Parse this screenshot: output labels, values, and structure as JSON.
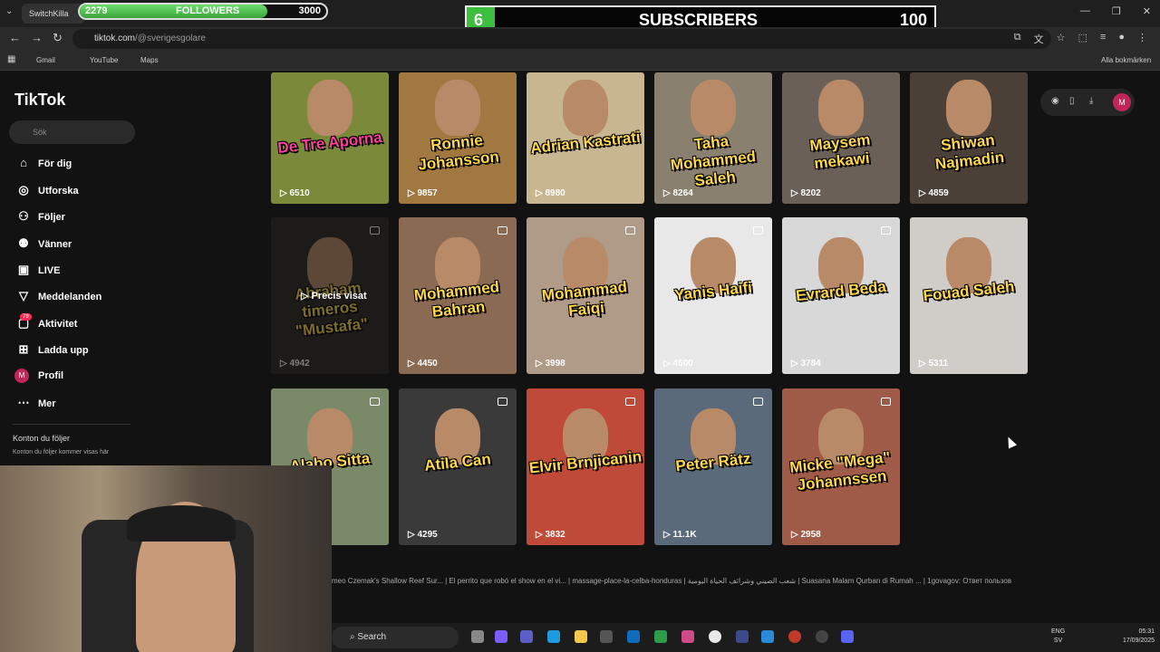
{
  "browser": {
    "tab_title": "SwitchKilla",
    "url_host": "tiktok.com",
    "url_path": "/@sverigesgolare",
    "bookmarks": [
      "Gmail",
      "YouTube",
      "Maps"
    ],
    "all_bookmarks": "Alla bokmärken"
  },
  "overlay": {
    "followers_current": "2279",
    "followers_label": "FOLLOWERS",
    "followers_goal": "3000",
    "followers_fraction": 0.76,
    "subs_current": "6",
    "subs_label": "SUBSCRIBERS",
    "subs_goal": "100",
    "subs_fraction": 0.06
  },
  "sidebar": {
    "logo": "TikTok",
    "search_placeholder": "Sök",
    "items": [
      {
        "label": "För dig",
        "icon": "home-icon"
      },
      {
        "label": "Utforska",
        "icon": "compass-icon"
      },
      {
        "label": "Följer",
        "icon": "following-icon"
      },
      {
        "label": "Vänner",
        "icon": "friends-icon"
      },
      {
        "label": "LIVE",
        "icon": "live-icon"
      },
      {
        "label": "Meddelanden",
        "icon": "messages-icon"
      },
      {
        "label": "Aktivitet",
        "icon": "activity-icon"
      },
      {
        "label": "Ladda upp",
        "icon": "upload-icon"
      },
      {
        "label": "Profil",
        "icon": "profile-icon"
      },
      {
        "label": "Mer",
        "icon": "more-icon"
      }
    ],
    "activity_badge": "79",
    "profile_initial": "M",
    "following_heading": "Konton du följer",
    "following_note": "Konton du följer kommer visas här"
  },
  "videos": [
    {
      "title": "De Tre Aporna",
      "views": "6510",
      "color": "#7a8a3a"
    },
    {
      "title": "Ronnie Johansson",
      "views": "9857",
      "color": "#a07840"
    },
    {
      "title": "Adrian Kastrati",
      "views": "8980",
      "color": "#c8b690"
    },
    {
      "title": "Taha Mohammed Saleh",
      "views": "8264",
      "color": "#8a8070"
    },
    {
      "title": "Maysem mekawi",
      "views": "8202",
      "color": "#6a6058"
    },
    {
      "title": "Shiwan Najmadin",
      "views": "4859",
      "color": "#4a4038"
    },
    {
      "title": "Abraham timeros \"Mustafa\"",
      "views": "4942",
      "color": "#2a2624"
    },
    {
      "title": "Mohammed Bahran",
      "views": "4450",
      "color": "#8a6a52"
    },
    {
      "title": "Mohammad Faiqi",
      "views": "3998",
      "color": "#b09a88"
    },
    {
      "title": "Yanis Haifi",
      "views": "4600",
      "color": "#e8e8e8"
    },
    {
      "title": "Evrard Beda",
      "views": "3784",
      "color": "#d8d8d8"
    },
    {
      "title": "Fouad Saleh",
      "views": "5311",
      "color": "#d0ccc8"
    },
    {
      "title": "Alabo Sitta",
      "views": "",
      "color": "#7a8a68"
    },
    {
      "title": "Atila Can",
      "views": "4295",
      "color": "#3a3a3a"
    },
    {
      "title": "Elvir Brnjicanin",
      "views": "3832",
      "color": "#c04a3a"
    },
    {
      "title": "Peter Rätz",
      "views": "11.1K",
      "color": "#5a6a7a"
    },
    {
      "title": "Micke \"Mega\" Johannssen",
      "views": "2958",
      "color": "#a05a48"
    }
  ],
  "precis_visat": "Precis visat",
  "trending": "meo Czemak's Shallow Reef Sur...   |   El perrito que robó el show en el vi...   |   massage-place-la-celba-honduras   |   شعب الصيني وشرائف الحياة اليومية   |   Suasana Malam Qurban di Rumah ...   |   1govagov: Ответ пользов",
  "taskbar": {
    "search_label": "Search",
    "lang_top": "ENG",
    "lang_bottom": "SV",
    "time": "05:31",
    "date": "17/09/2025"
  }
}
